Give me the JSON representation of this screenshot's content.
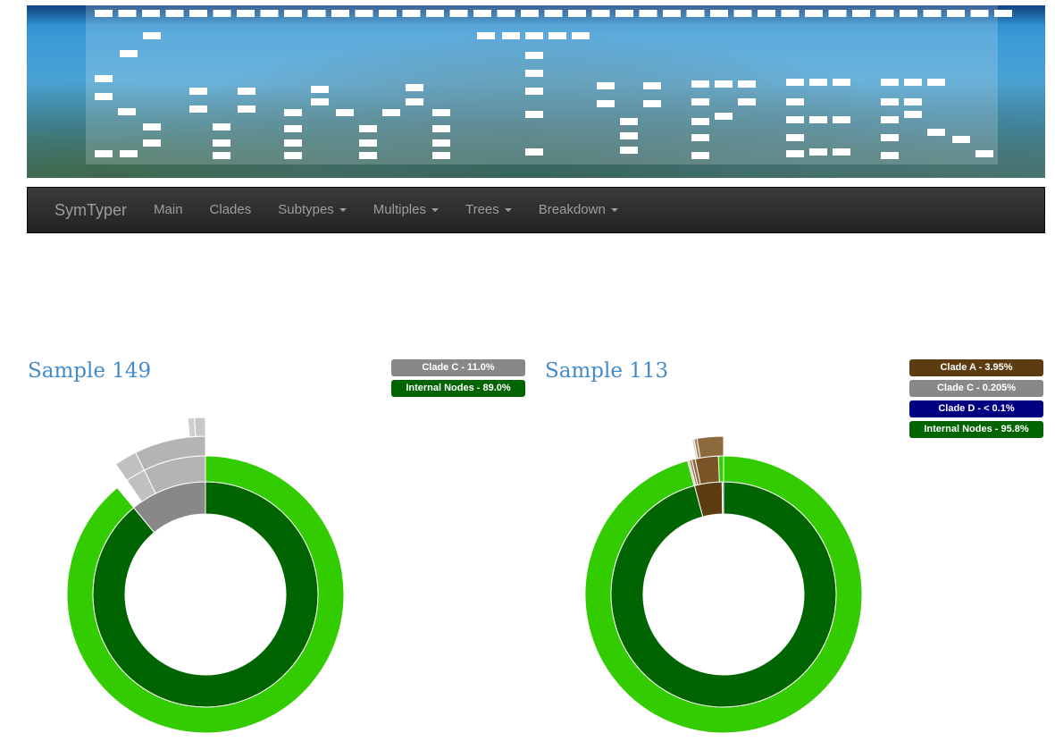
{
  "nav": {
    "brand": "SymTyper",
    "items": [
      {
        "label": "Main",
        "dropdown": false
      },
      {
        "label": "Clades",
        "dropdown": false
      },
      {
        "label": "Subtypes",
        "dropdown": true
      },
      {
        "label": "Multiples",
        "dropdown": true
      },
      {
        "label": "Trees",
        "dropdown": true
      },
      {
        "label": "Breakdown",
        "dropdown": true
      }
    ]
  },
  "samples": [
    {
      "title": "Sample 149",
      "legend": [
        {
          "label": "Clade C - 11.0%",
          "color": "#888888"
        },
        {
          "label": "Internal Nodes - 89.0%",
          "color": "#006400"
        }
      ]
    },
    {
      "title": "Sample 113",
      "legend": [
        {
          "label": "Clade A - 3.95%",
          "color": "#5c3c10"
        },
        {
          "label": "Clade C - 0.205%",
          "color": "#888888"
        },
        {
          "label": "Clade D - < 0.1%",
          "color": "#000080"
        },
        {
          "label": "Internal Nodes - 95.8%",
          "color": "#006400"
        }
      ]
    }
  ],
  "chart_data": [
    {
      "type": "sunburst",
      "title": "Sample 149",
      "rings": [
        {
          "segments": [
            {
              "name": "Internal Nodes",
              "value": 89.0,
              "color": "#006400"
            },
            {
              "name": "Clade C",
              "value": 11.0,
              "color": "#888888"
            }
          ]
        },
        {
          "segments": [
            {
              "parent": "Internal Nodes",
              "value": 89.0,
              "color": "#33cc00"
            },
            {
              "parent": "Clade C",
              "value": 7.3,
              "color": "#b4b4b4"
            },
            {
              "parent": "Clade C",
              "value": 2.3,
              "color": "#c0c0c0"
            }
          ]
        },
        {
          "segments": [
            {
              "parent": "Clade C",
              "value": 7.3,
              "color": "#b4b4b4"
            },
            {
              "parent": "Clade C",
              "value": 2.3,
              "color": "#c0c0c0"
            }
          ]
        },
        {
          "segments": [
            {
              "parent": "Clade C",
              "value": 1.0,
              "color": "#c8c8c8"
            },
            {
              "parent": "Clade C",
              "value": 0.6,
              "color": "#d0d0d0"
            }
          ]
        }
      ]
    },
    {
      "type": "sunburst",
      "title": "Sample 113",
      "rings": [
        {
          "segments": [
            {
              "name": "Internal Nodes",
              "value": 95.8,
              "color": "#006400"
            },
            {
              "name": "Clade A",
              "value": 3.95,
              "color": "#5c3c10"
            },
            {
              "name": "Clade C",
              "value": 0.205,
              "color": "#888888"
            }
          ]
        },
        {
          "segments": [
            {
              "parent": "Internal Nodes",
              "value": 95.8,
              "color": "#33cc00"
            },
            {
              "parent": "Internal Nodes",
              "value": 0.6,
              "color": "#33cc00"
            },
            {
              "parent": "Clade A",
              "value": 2.7,
              "color": "#7a5426"
            },
            {
              "parent": "Clade A",
              "value": 0.4,
              "color": "#8d6a3d"
            },
            {
              "parent": "Clade A",
              "value": 0.3,
              "color": "#a08058"
            },
            {
              "parent": "Clade C",
              "value": 0.2,
              "color": "#bbbbbb"
            }
          ]
        },
        {
          "segments": [
            {
              "parent": "Clade A",
              "value": 2.7,
              "color": "#8d6a3d"
            },
            {
              "parent": "Clade A",
              "value": 0.3,
              "color": "#a08058"
            },
            {
              "parent": "Clade C",
              "value": 0.2,
              "color": "#c8c8c8"
            }
          ]
        }
      ]
    }
  ]
}
